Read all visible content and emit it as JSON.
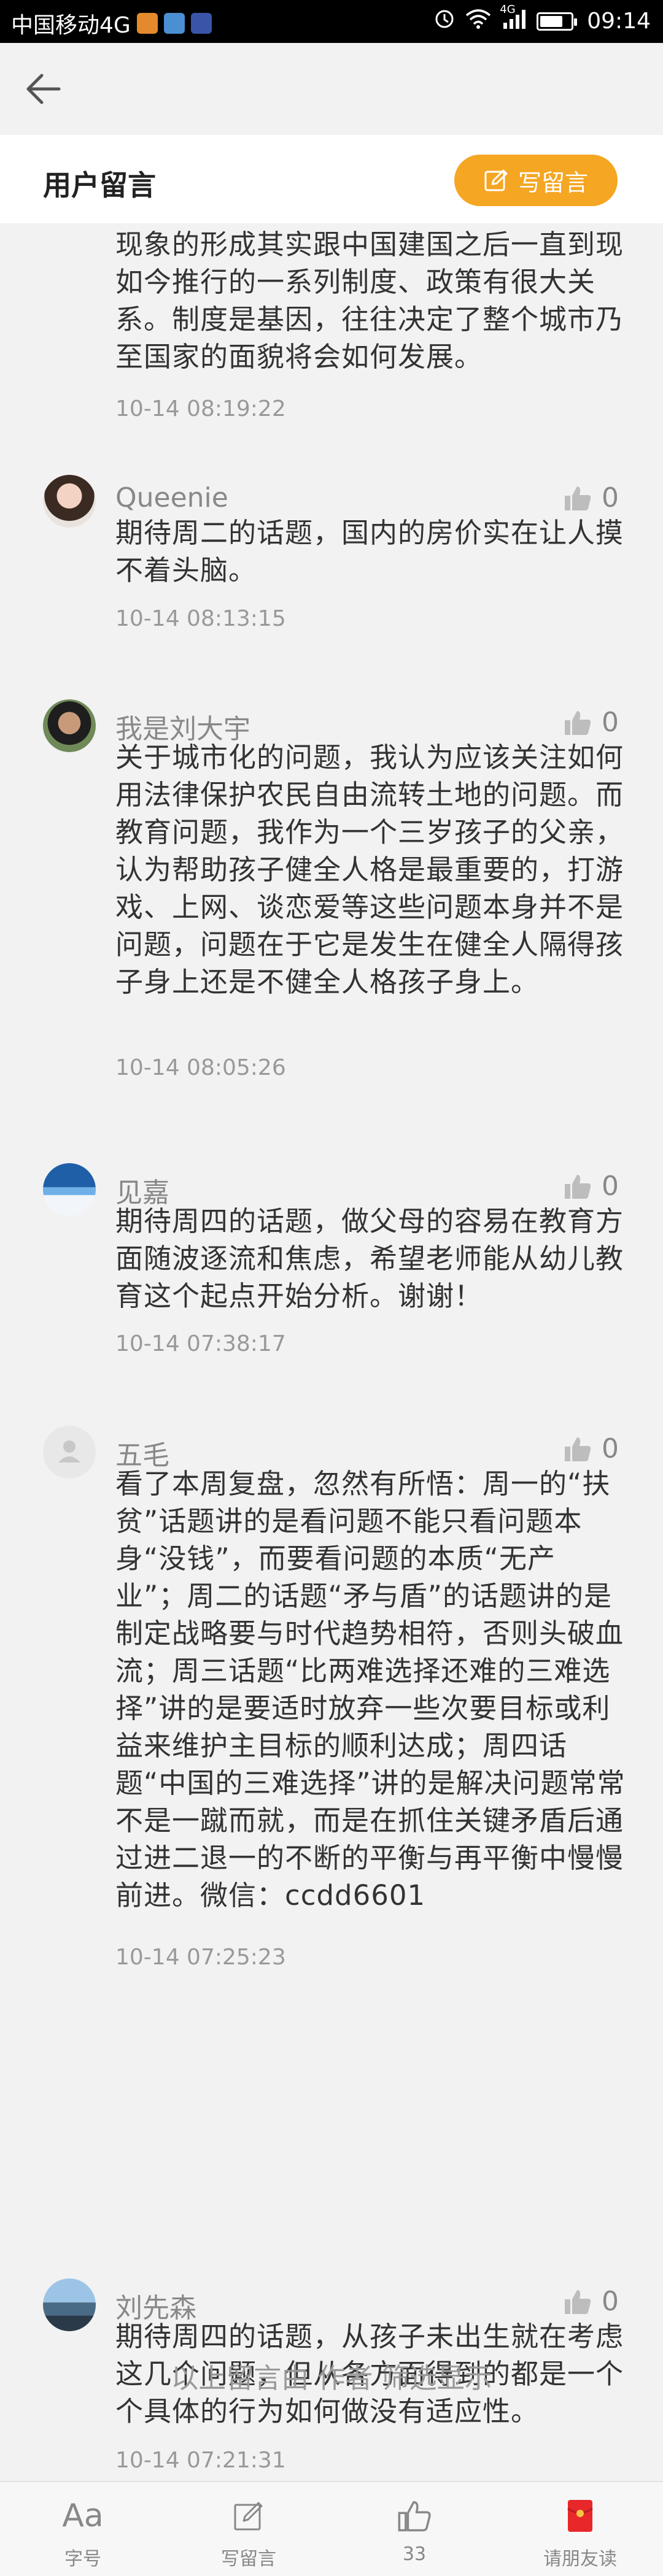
{
  "status_bar": {
    "carrier": "中国移动4G",
    "network": "4G",
    "time": "09:14"
  },
  "header": {
    "title": "用户留言",
    "write_button_label": "写留言"
  },
  "comments": [
    {
      "name": "",
      "body": "现象的形成其实跟中国建国之后一直到现如今推行的一系列制度、政策有很大关系。制度是基因，往往决定了整个城市乃至国家的面貌将会如何发展。",
      "time": "10-14 08:19:22",
      "likes": ""
    },
    {
      "name": "Queenie",
      "body": "期待周二的话题，国内的房价实在让人摸不着头脑。",
      "time": "10-14 08:13:15",
      "likes": "0"
    },
    {
      "name": "我是刘大宇",
      "body": "关于城市化的问题，我认为应该关注如何用法律保护农民自由流转土地的问题。而教育问题，我作为一个三岁孩子的父亲，认为帮助孩子健全人格是最重要的，打游戏、上网、谈恋爱等这些问题本身并不是问题，问题在于它是发生在健全人隔得孩子身上还是不健全人格孩子身上。",
      "time": "10-14 08:05:26",
      "likes": "0"
    },
    {
      "name": "见嘉",
      "body": "期待周四的话题，做父母的容易在教育方面随波逐流和焦虑，希望老师能从幼儿教育这个起点开始分析。谢谢！",
      "time": "10-14 07:38:17",
      "likes": "0"
    },
    {
      "name": "五毛",
      "body": "看了本周复盘，忽然有所悟：周一的“扶贫”话题讲的是看问题不能只看问题本身“没钱”，而要看问题的本质“无产业”；周二的话题“矛与盾”的话题讲的是制定战略要与时代趋势相符，否则头破血流；周三话题“比两难选择还难的三难选择”讲的是要适时放弃一些次要目标或利益来维护主目标的顺利达成；周四话题“中国的三难选择”讲的是解决问题常常不是一蹴而就，而是在抓住关键矛盾后通过进二退一的不断的平衡与再平衡中慢慢前进。微信：ccdd6601",
      "time": "10-14 07:25:23",
      "likes": "0"
    },
    {
      "name": "刘先森",
      "body": "期待周四的话题，从孩子未出生就在考虑这几个问题，但从各方面得到的都是一个个具体的行为如何做没有适应性。",
      "time": "10-14 07:21:31",
      "likes": "0"
    }
  ],
  "filter_note": "以上留言由 作者 筛选显示",
  "bottom_bar": {
    "font_label": "字号",
    "font_glyph": "Aa",
    "write_label": "写留言",
    "like_count": "33",
    "share_label": "请朋友读"
  },
  "colors": {
    "accent": "#f5a623",
    "like_gray": "#bdbdbd",
    "share_red": "#e8272b"
  }
}
